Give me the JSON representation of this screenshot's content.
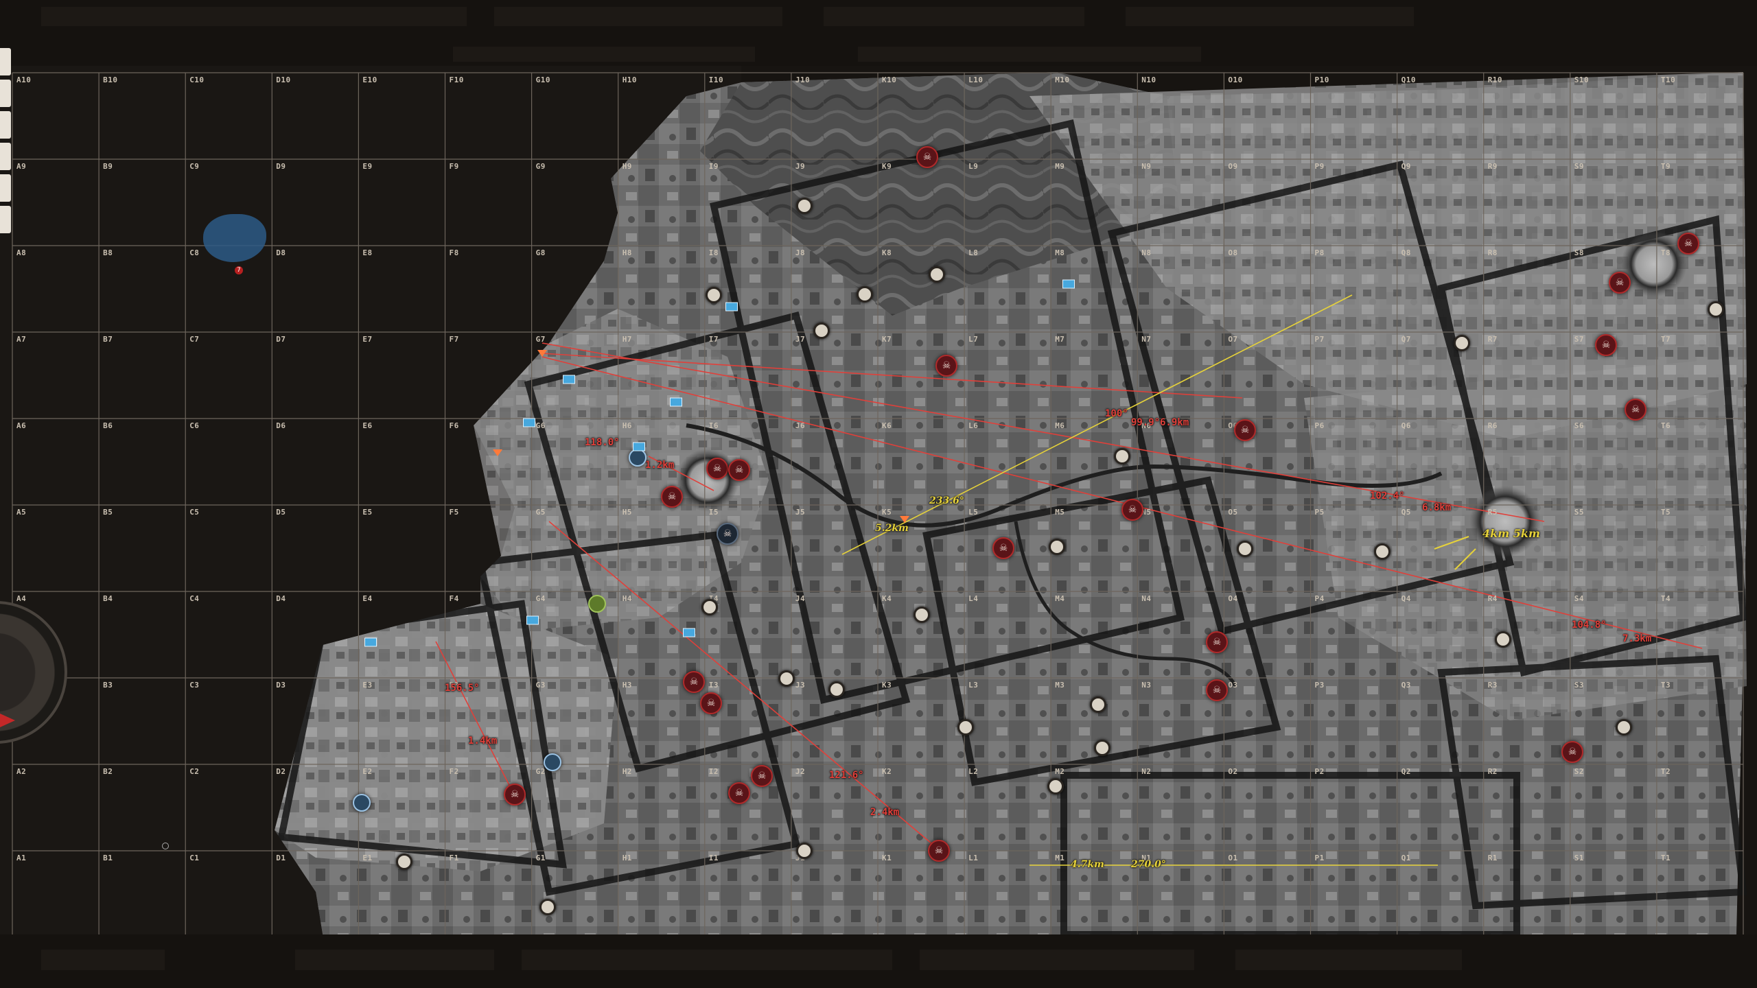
{
  "grid": {
    "columns": [
      "A",
      "B",
      "C",
      "D",
      "E",
      "F",
      "G",
      "H",
      "I",
      "J",
      "K",
      "L",
      "M",
      "N",
      "O",
      "P",
      "Q",
      "R",
      "S",
      "T"
    ],
    "rows": [
      "10",
      "9",
      "8",
      "7",
      "6",
      "5",
      "4",
      "3",
      "2",
      "1"
    ]
  },
  "measurements": [
    {
      "id": "m1",
      "text": "100°",
      "color": "red"
    },
    {
      "id": "m2",
      "text": "99.9°",
      "color": "red"
    },
    {
      "id": "m3",
      "text": "6.9km",
      "color": "red"
    },
    {
      "id": "m4",
      "text": "102.4°",
      "color": "red"
    },
    {
      "id": "m5",
      "text": "6.8km",
      "color": "red"
    },
    {
      "id": "m6",
      "text": "104.8°",
      "color": "red"
    },
    {
      "id": "m7",
      "text": "7.3km",
      "color": "red"
    },
    {
      "id": "m8",
      "text": "118.0°",
      "color": "red"
    },
    {
      "id": "m9",
      "text": "1.2km",
      "color": "red"
    },
    {
      "id": "m10",
      "text": "156.5°",
      "color": "red"
    },
    {
      "id": "m11",
      "text": "1.4km",
      "color": "red"
    },
    {
      "id": "m12",
      "text": "121.6°",
      "color": "red"
    },
    {
      "id": "m13",
      "text": "2.4km",
      "color": "red"
    },
    {
      "id": "m14",
      "text": "233.6°",
      "color": "yellow"
    },
    {
      "id": "m15",
      "text": "5.2km",
      "color": "yellow"
    },
    {
      "id": "m16",
      "text": "4km 5km",
      "color": "yellow"
    },
    {
      "id": "m17",
      "text": "4.7km",
      "color": "yellow"
    },
    {
      "id": "m18",
      "text": "270.0°",
      "color": "yellow"
    }
  ],
  "markers": [
    {
      "id": "enemy-1",
      "type": "skull"
    },
    {
      "id": "enemy-2",
      "type": "skull"
    },
    {
      "id": "enemy-3",
      "type": "skull"
    },
    {
      "id": "enemy-4",
      "type": "skull"
    },
    {
      "id": "enemy-5",
      "type": "skull"
    },
    {
      "id": "enemy-6",
      "type": "skull"
    },
    {
      "id": "enemy-7",
      "type": "skull"
    },
    {
      "id": "enemy-8",
      "type": "skull"
    },
    {
      "id": "enemy-9",
      "type": "skull"
    },
    {
      "id": "enemy-10",
      "type": "skull"
    },
    {
      "id": "enemy-11",
      "type": "skull"
    },
    {
      "id": "enemy-12",
      "type": "skull"
    },
    {
      "id": "enemy-13",
      "type": "skull"
    },
    {
      "id": "enemy-14",
      "type": "skull"
    },
    {
      "id": "enemy-15",
      "type": "skull"
    },
    {
      "id": "enemy-16",
      "type": "skull"
    },
    {
      "id": "enemy-17",
      "type": "skull"
    },
    {
      "id": "enemy-18",
      "type": "skull"
    },
    {
      "id": "enemy-19",
      "type": "skull"
    },
    {
      "id": "enemy-20",
      "type": "skull"
    },
    {
      "id": "enemy-21",
      "type": "skull"
    }
  ],
  "colors": {
    "background": "#171411",
    "grid_line": "#6d655c",
    "grid_label": "#c9bfb0",
    "measure_red": "#e0403a",
    "measure_yellow": "#e6d23a",
    "marker_red": "#5a1418"
  },
  "icons": {
    "enemy": "skull-icon",
    "waypoint": "waypoint-icon",
    "camera": "camera-icon",
    "compass": "compass-icon"
  }
}
